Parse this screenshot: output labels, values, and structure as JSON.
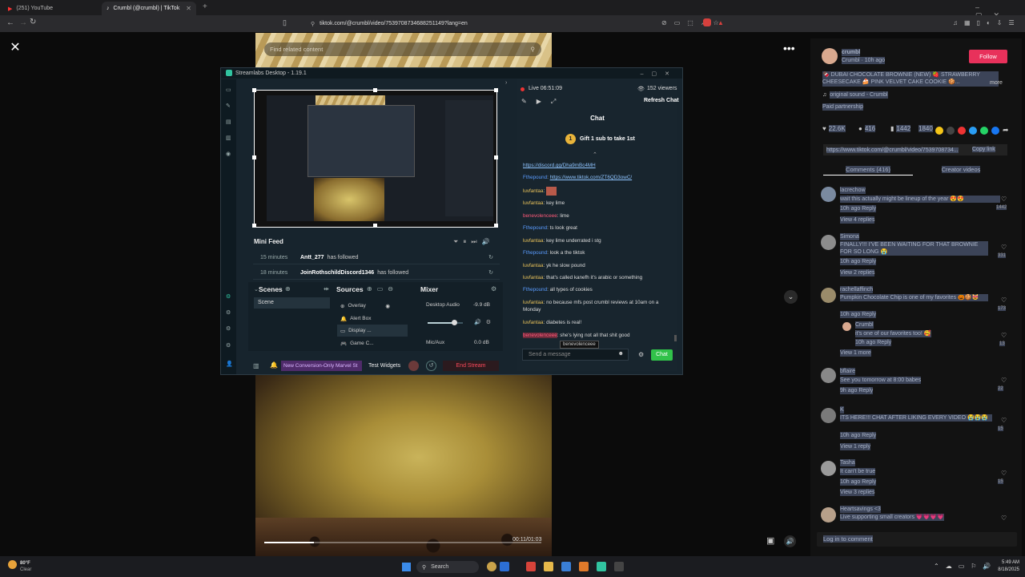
{
  "browser": {
    "tabs": [
      {
        "label": "(251) YouTube",
        "icon": "youtube-icon"
      },
      {
        "label": "Crumbl (@crumbl) | TikTok",
        "icon": "tiktok-icon"
      }
    ],
    "url": "tiktok.com/@crumbl/video/7539708734688251149?lang=en"
  },
  "video": {
    "search_placeholder": "Find related content",
    "progress_fraction": 0.18,
    "time_display": "00:11/01:03"
  },
  "post": {
    "author": "crumbl",
    "author_sub": "Crumbl · 10h ago",
    "follow_label": "Follow",
    "caption": "🍫 DUBAI CHOCOLATE BROWNIE (NEW) 🍓 STRAWBERRY CHEESECAKE 🍰 PINK VELVET CAKE COOKIE 🍪...",
    "more_label": "more",
    "sound": "original sound - Crumbl",
    "paid": "Paid partnership",
    "likes": "22.6K",
    "comments_count": "416",
    "saves": "1442",
    "shares": "1840",
    "link": "https://www.tiktok.com/@crumbl/video/7539708734...",
    "copy_link": "Copy link",
    "tab_comments": "Comments (416)",
    "tab_creator": "Creator videos",
    "login_comment": "Log in to comment"
  },
  "comments": [
    {
      "user": "lacrechow",
      "text": "wait this actually might be lineup of the year 😍😍",
      "meta": "10h ago   Reply",
      "replies": "View 4 replies",
      "count": "1442"
    },
    {
      "user": "Simona",
      "text": "FINALLY!!! I'VE BEEN WAITING FOR THAT BROWNIE FOR SO LONG 😭",
      "meta": "10h ago   Reply",
      "replies": "View 2 replies",
      "count": "331"
    },
    {
      "user": "rachellaffinch",
      "text": "Pumpkin Chocolate Chip is one of my favorites 🎃🍪😻",
      "meta": "10h ago   Reply",
      "replies": "",
      "count": "173"
    },
    {
      "user": "Crumbl",
      "text": "it's one of our favorites too! 🥰",
      "meta": "10h ago   Reply",
      "replies": "View 1 more",
      "count": "13"
    },
    {
      "user": "bflaire",
      "text": "See you tomorrow at 8:00 babes",
      "meta": "9h ago   Reply",
      "replies": "",
      "count": "22"
    },
    {
      "user": "K",
      "text": "ITS HERE!!! CHAT AFTER LIKING EVERY VIDEO 😭😭😭",
      "meta": "10h ago   Reply",
      "replies": "View 1 reply",
      "count": "15"
    },
    {
      "user": "Tasha",
      "text": "It can't be true",
      "meta": "10h ago   Reply",
      "replies": "View 3 replies",
      "count": "15"
    },
    {
      "user": "Heartsavings <3",
      "text": "Live supporting small creators 💗💗💗💗",
      "meta": "",
      "replies": "",
      "count": ""
    }
  ],
  "streamlabs": {
    "title": "Streamlabs Desktop - 1.19.1",
    "live_status": "Live 06:51:09",
    "viewers": "152 viewers",
    "refresh_chat": "Refresh Chat",
    "chat_title": "Chat",
    "gift": "Gift 1 sub to take 1st",
    "mini_feed": "Mini Feed",
    "feed": [
      {
        "time": "15 minutes",
        "user": "Antt_277",
        "action": "has followed"
      },
      {
        "time": "18 minutes",
        "user": "JoinRothschildDiscord1346",
        "action": "has followed"
      }
    ],
    "scenes_label": "Scenes",
    "scene_item": "Scene",
    "sources_label": "Sources",
    "sources": [
      "Overlay",
      "Alert Box",
      "Display ...",
      "Game C..."
    ],
    "mixer_label": "Mixer",
    "desktop_audio": "Desktop Audio",
    "desktop_audio_db": "-9.9 dB",
    "desktop_audio_level": 0.75,
    "mic_aux": "Mic/Aux",
    "mic_aux_db": "0.0 dB",
    "conversion_btn": "New Conversion-Only Marvel St",
    "test_widgets": "Test Widgets",
    "end_stream": "End Stream",
    "message_placeholder": "Send a message",
    "chat_btn": "Chat",
    "tooltip": "benevolenceee",
    "chat_link_top": "https://discord.gg/Dha9mBc4MH",
    "messages": [
      {
        "user": "Fthepound",
        "text": "https://www.tiktok.com/ZT6QD3owC/",
        "kind": "f",
        "link": true
      },
      {
        "user": "luvfantaa",
        "text": "",
        "kind": "l",
        "emote": true
      },
      {
        "user": "luvfantaa",
        "text": "key lime",
        "kind": "l"
      },
      {
        "user": "benevolenceee",
        "text": "lime",
        "kind": "b"
      },
      {
        "user": "Fthepound",
        "text": "ts look great",
        "kind": "f"
      },
      {
        "user": "luvfantaa",
        "text": "key lime underrated i stg",
        "kind": "l"
      },
      {
        "user": "Fthepound",
        "text": "look a the tiktok",
        "kind": "f"
      },
      {
        "user": "luvfantaa",
        "text": "yk he slow pound",
        "kind": "l"
      },
      {
        "user": "luvfantaa",
        "text": "that's called kanefh it's arabic or something",
        "kind": "l"
      },
      {
        "user": "Fthepound",
        "text": "all types of cookies",
        "kind": "f"
      },
      {
        "user": "luvfantaa",
        "text": "no because mfs post crumbl reviews at 10am on a Monday",
        "kind": "l"
      },
      {
        "user": "luvfantaa",
        "text": "diabetes is real!",
        "kind": "l"
      },
      {
        "user": "benevolenceee",
        "text": "she's lying not all that shit good",
        "kind": "b"
      }
    ]
  },
  "taskbar": {
    "weather_temp": "80°F",
    "weather_desc": "Clear",
    "search_label": "Search",
    "time": "5:49 AM",
    "date": "8/18/2025"
  }
}
